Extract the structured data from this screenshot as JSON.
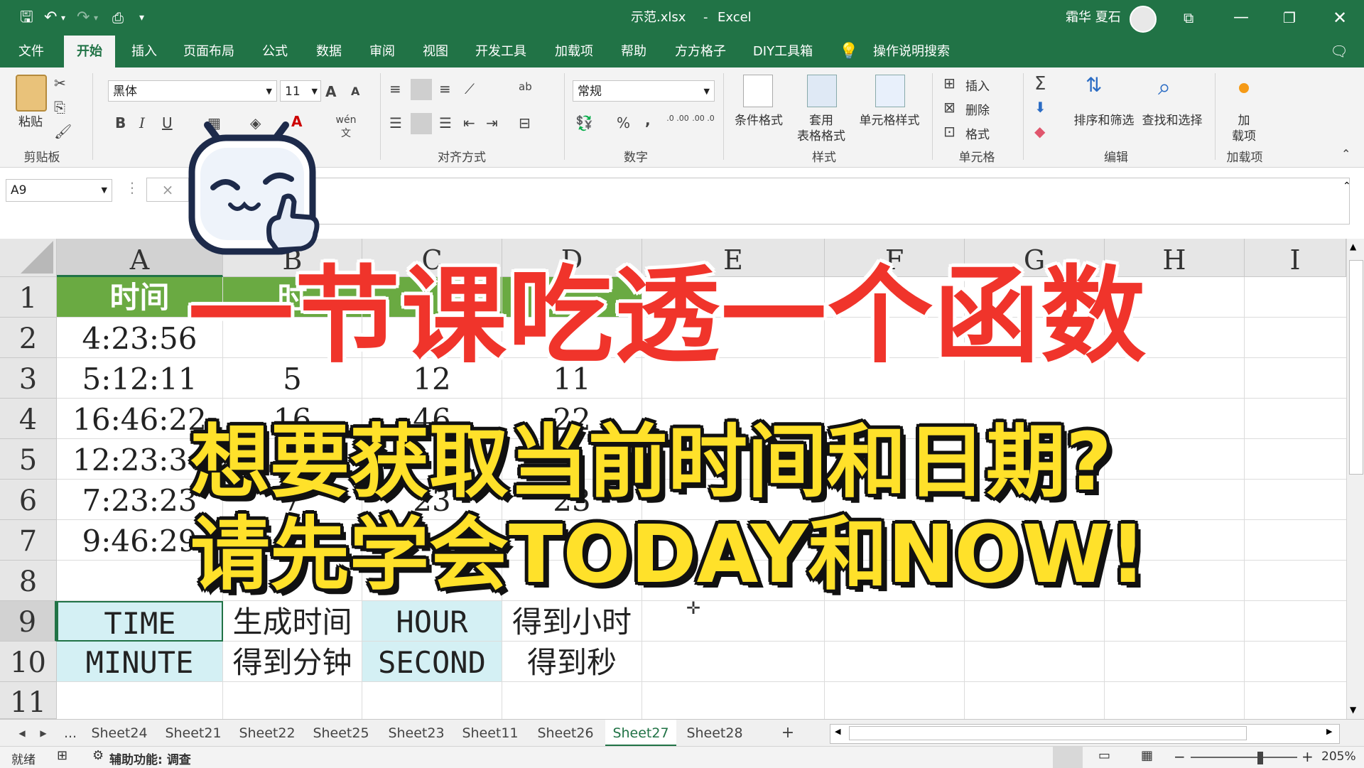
{
  "titlebar": {
    "filename": "示范.xlsx",
    "separator": "-",
    "app": "Excel",
    "user": "霜华 夏石",
    "qat": {
      "save": "save-icon",
      "undo": "undo-icon",
      "redo": "redo-icon",
      "preview": "print-preview-icon",
      "customize": "▾"
    }
  },
  "menu": {
    "items": [
      "文件",
      "开始",
      "插入",
      "页面布局",
      "公式",
      "数据",
      "审阅",
      "视图",
      "开发工具",
      "加载项",
      "帮助",
      "方方格子",
      "DIY工具箱"
    ],
    "active": "开始",
    "search": "操作说明搜索"
  },
  "ribbon": {
    "clipboard": {
      "paste": "粘贴",
      "group": "剪贴板"
    },
    "font": {
      "name": "黑体",
      "size": "11",
      "bold": "B",
      "italic": "I",
      "underline": "U",
      "grow": "A",
      "shrink": "A",
      "wen": "wén 文"
    },
    "alignment": {
      "group": "对齐方式"
    },
    "number": {
      "format": "常规",
      "percent": "%",
      "comma": ",",
      "inc_dec": ".0 .00",
      "dec_dec": ".00 .0",
      "group": "数字"
    },
    "styles": {
      "cond": "条件格式",
      "table1": "套用",
      "table2": "表格格式",
      "cellstyle": "单元格样式",
      "group": "样式"
    },
    "cells": {
      "insert": "插入",
      "delete": "删除",
      "format": "格式",
      "group": "单元格"
    },
    "editing": {
      "sort": "排序和筛选",
      "find": "查找和选择",
      "group": "编辑"
    },
    "addins": {
      "label1": "加",
      "label2": "载项",
      "group": "加载项"
    }
  },
  "formula_bar": {
    "namebox": "A9",
    "fx": "×",
    "value": ""
  },
  "grid": {
    "columns": [
      "A",
      "B",
      "C",
      "D",
      "E",
      "F",
      "G",
      "H",
      "I"
    ],
    "rows": [
      "1",
      "2",
      "3",
      "4",
      "5",
      "6",
      "7",
      "8",
      "9",
      "10",
      "11"
    ],
    "cells": {
      "A1": "时间",
      "B1": "时",
      "A2": "4:23:56",
      "C2": "4",
      "D2": "",
      "A3": "5:12:11",
      "B3": "5",
      "C3": "12",
      "D3": "11",
      "A4": "16:46:22",
      "B4": "16",
      "C4": "46",
      "D4": "22",
      "A5": "12:23:34",
      "A6": "7:23:23",
      "B6": "7",
      "C6": "23",
      "D6": "23",
      "A7": "9:46:29",
      "A9": "TIME",
      "B9": "生成时间",
      "C9": "HOUR",
      "D9": "得到小时",
      "A10": "MINUTE",
      "B10": "得到分钟",
      "C10": "SECOND",
      "D10": "得到秒"
    }
  },
  "sheets": {
    "tabs": [
      "Sheet24",
      "Sheet21",
      "Sheet22",
      "Sheet25",
      "Sheet23",
      "Sheet11",
      "Sheet26",
      "Sheet27",
      "Sheet28"
    ],
    "active": "Sheet27",
    "ellipsis": "...",
    "add": "+"
  },
  "status": {
    "ready": "就绪",
    "accessibility": "辅助功能: 调查",
    "zoom": "205%",
    "minus": "−",
    "plus": "+"
  },
  "overlay": {
    "title": "一节课吃透一个函数",
    "line1": "想要获取当前时间和日期?",
    "line2": "请先学会TODAY和NOW!"
  },
  "colors": {
    "excel_green": "#217346",
    "header_green": "#6aaa42",
    "cyan_fill": "#d4f0f4",
    "overlay_red": "#f0342b",
    "overlay_yellow": "#ffe12a"
  }
}
